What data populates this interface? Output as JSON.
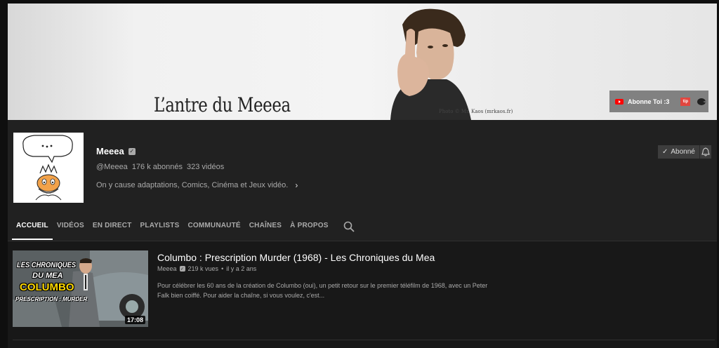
{
  "banner": {
    "title": "L’antre du Meeea",
    "photo_credit": "Photo © Mr. Kaos (mrkaos.fr)",
    "link_label": "Abonne Toi :3",
    "link_icons": [
      "youtube-icon",
      "tipeee-icon",
      "pacman-icon"
    ],
    "tipeee_text": "tip"
  },
  "channel": {
    "name": "Meeea",
    "handle": "@Meeea",
    "subscribers": "176 k abonnés",
    "videos": "323 vidéos",
    "description": "On y cause adaptations, Comics, Cinéma et Jeux vidéo.",
    "subscribed_label": "Abonné"
  },
  "tabs": [
    {
      "label": "ACCUEIL",
      "active": true
    },
    {
      "label": "VIDÉOS"
    },
    {
      "label": "EN DIRECT"
    },
    {
      "label": "PLAYLISTS"
    },
    {
      "label": "COMMUNAUTÉ"
    },
    {
      "label": "CHAÎNES"
    },
    {
      "label": "À PROPOS"
    }
  ],
  "video": {
    "title": "Columbo : Prescription Murder (1968) - Les Chroniques du Mea",
    "channel": "Meeea",
    "views": "219 k vues",
    "age": "il y a 2 ans",
    "duration": "17:08",
    "description": "Pour célébrer les 60 ans de la création de Columbo (oui), un petit retour sur le premier téléfilm de 1968, avec un Peter Falk bien coiffé. Pour aider la chaîne, si vous voulez, c'est...",
    "thumb_line1": "LES CHRONIQUES",
    "thumb_line2": "DU MEA",
    "thumb_line3": "COLUMBO",
    "thumb_line4": "PRESCRIPTION : MURDER"
  },
  "colors": {
    "background": "#181818",
    "header": "#212121",
    "accent_red": "#ff0000"
  }
}
